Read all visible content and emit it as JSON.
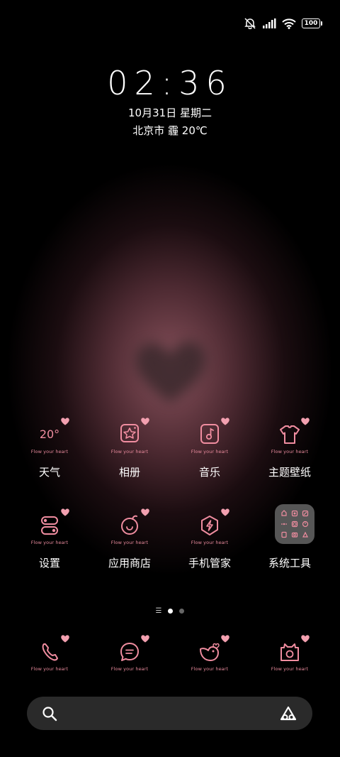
{
  "status": {
    "icons": [
      "mute-icon",
      "signal-icon",
      "wifi-icon",
      "battery-icon"
    ],
    "battery": "100"
  },
  "lockclock": {
    "time": "02:36",
    "date": "10月31日 星期二",
    "weather": "北京市 霾 20℃"
  },
  "theme": {
    "tagline": "Flow your heart",
    "accent": "#f08da0"
  },
  "apps_row1": [
    {
      "label": "天气",
      "glyph": "20°",
      "icon": "weather-icon"
    },
    {
      "label": "相册",
      "icon": "gallery-icon"
    },
    {
      "label": "音乐",
      "icon": "music-icon"
    },
    {
      "label": "主题壁纸",
      "icon": "themes-icon"
    }
  ],
  "apps_row2": [
    {
      "label": "设置",
      "icon": "settings-icon"
    },
    {
      "label": "应用商店",
      "icon": "app-store-icon"
    },
    {
      "label": "手机管家",
      "icon": "security-icon"
    },
    {
      "label": "系统工具",
      "icon": "folder-icon"
    }
  ],
  "dock": [
    {
      "icon": "phone-icon"
    },
    {
      "icon": "messages-icon"
    },
    {
      "icon": "browser-icon"
    },
    {
      "icon": "camera-icon"
    }
  ],
  "pager": {
    "count": 2,
    "active": 0
  },
  "search": {
    "left_icon": "search-icon",
    "right_icon": "assistant-icon"
  }
}
